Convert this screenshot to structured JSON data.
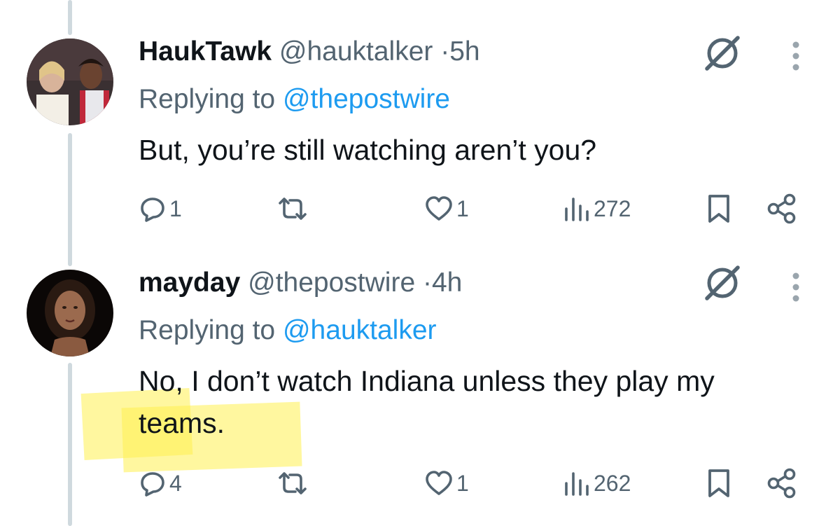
{
  "tweets": [
    {
      "name": "HaukTawk",
      "handle": "@hauktalker",
      "separator": "·",
      "time": "5h",
      "replying_label": "Replying to",
      "replying_to": "@thepostwire",
      "text": "But, you’re still watching aren’t you?",
      "replies": "1",
      "likes": "1",
      "views": "272"
    },
    {
      "name": "mayday",
      "handle": "@thepostwire",
      "separator": "·",
      "time": "4h",
      "replying_label": "Replying to",
      "replying_to": "@hauktalker",
      "text_line1": "No, I don’t watch Indiana unless they play my",
      "text_line2": "teams.",
      "replies": "4",
      "likes": "1",
      "views": "262"
    }
  ],
  "colors": {
    "link": "#1d9bf0",
    "secondary": "#536471",
    "thread": "#cfd9de",
    "highlight": "#fff050"
  }
}
